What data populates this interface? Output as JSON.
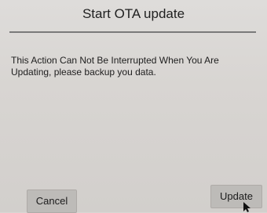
{
  "dialog": {
    "title": "Start OTA update",
    "message": "This Action Can Not Be Interrupted When You Are Updating, please backup you data.",
    "buttons": {
      "cancel_label": "Cancel",
      "update_label": "Update"
    }
  },
  "icons": {
    "cursor": "mouse-pointer-icon"
  }
}
